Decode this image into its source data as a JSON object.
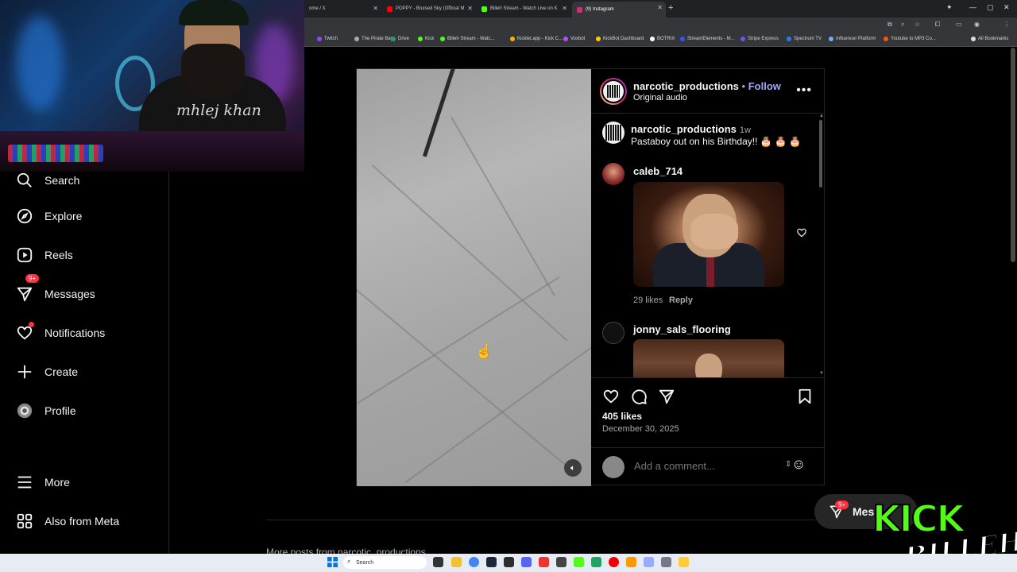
{
  "browser": {
    "tabs": [
      {
        "title": "ome / X",
        "color": "#ffffff"
      },
      {
        "title": "POPPY - Bruised Sky (Official M",
        "color": "#ff0000"
      },
      {
        "title": "Billeh Stream - Watch Live on K",
        "color": "#53fc18"
      },
      {
        "title": "(9) Instagram",
        "color": "#d62976"
      }
    ],
    "new_tab": "+",
    "bookmarks": [
      {
        "label": "Twitch",
        "color": "#9146ff"
      },
      {
        "label": "The Pirate Bay",
        "color": "#aaaaaa"
      },
      {
        "label": "Drive",
        "color": "#1fa463"
      },
      {
        "label": "Kick",
        "color": "#53fc18"
      },
      {
        "label": "Billeh Stream - Watc...",
        "color": "#53fc18"
      },
      {
        "label": "Kicklet.app - Kick C...",
        "color": "#ffb000"
      },
      {
        "label": "Voxbot",
        "color": "#b44cff"
      },
      {
        "label": "KickBot Dashboard",
        "color": "#ffcc00"
      },
      {
        "label": "BOTRIX",
        "color": "#ffffff"
      },
      {
        "label": "StreamElements - M...",
        "color": "#3355ff"
      },
      {
        "label": "Stripe Express",
        "color": "#635bff"
      },
      {
        "label": "Spectrum TV",
        "color": "#2b7de9"
      },
      {
        "label": "Influencer Platform",
        "color": "#6ab0ff"
      },
      {
        "label": "Youtube to MP3 Co...",
        "color": "#ff5500"
      },
      {
        "label": "All Bookmarks",
        "color": "#dddddd"
      }
    ]
  },
  "webcam": {
    "shirt_text": "mhlej khan"
  },
  "nav": {
    "items": [
      {
        "label": "Search",
        "icon": "search-icon"
      },
      {
        "label": "Explore",
        "icon": "compass-icon"
      },
      {
        "label": "Reels",
        "icon": "reels-icon"
      },
      {
        "label": "Messages",
        "icon": "messages-icon",
        "badge": "9+"
      },
      {
        "label": "Notifications",
        "icon": "heart-icon"
      },
      {
        "label": "Create",
        "icon": "plus-icon"
      },
      {
        "label": "Profile",
        "icon": "avatar"
      },
      {
        "label": "More",
        "icon": "menu-icon"
      },
      {
        "label": "Also from Meta",
        "icon": "meta-icon"
      }
    ]
  },
  "post": {
    "author": "narcotic_productions",
    "separator": "•",
    "follow": "Follow",
    "audio": "Original audio",
    "more": "•••",
    "caption": {
      "user": "narcotic_productions",
      "time": "1w",
      "text": "Pastaboy out on his Birthday!! 🎂 🎂 🎂"
    },
    "comments": [
      {
        "user": "caleb_714",
        "likes": "29 likes",
        "reply": "Reply"
      },
      {
        "user": "jonny_sals_flooring"
      }
    ],
    "likes": "405 likes",
    "date": "December 30, 2025",
    "comment_placeholder": "Add a comment..."
  },
  "messages_pill": {
    "label": "Mes",
    "badge": "9+"
  },
  "watermark": {
    "word": "KICK",
    "name": "BILLEH"
  },
  "below": {
    "text": "More posts from narcotic_productions"
  },
  "taskbar": {
    "search_label": "Search"
  }
}
